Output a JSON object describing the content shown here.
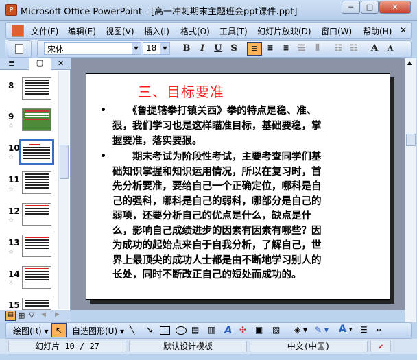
{
  "window": {
    "title": "Microsoft Office PowerPoint - [高一冲刺期末主题班会ppt课件.ppt]",
    "min": "─",
    "max": "□",
    "close": "✕"
  },
  "menu": {
    "items": [
      "文件(F)",
      "编辑(E)",
      "视图(V)",
      "插入(I)",
      "格式(O)",
      "工具(T)",
      "幻灯片放映(D)",
      "窗口(W)",
      "帮助(H)"
    ],
    "close": "✕"
  },
  "toolbar": {
    "font": "宋体",
    "size": "18",
    "bold": "B",
    "italic": "I",
    "underline": "U",
    "shadow": "S",
    "grow": "A",
    "shrink": "A"
  },
  "panel": {
    "tab_outline": "≣",
    "tab_slides": "▢",
    "close": "✕"
  },
  "thumbnails": [
    {
      "num": "8"
    },
    {
      "num": "9"
    },
    {
      "num": "10",
      "selected": true
    },
    {
      "num": "11"
    },
    {
      "num": "12"
    },
    {
      "num": "13"
    },
    {
      "num": "14"
    },
    {
      "num": "15"
    }
  ],
  "slide": {
    "title": "三、目标要准",
    "bullet": "•",
    "p1": [
      "　　《鲁提辖拳打镇关西》拳的特点是稳、准、",
      "狠，我们学习也是这样瞄准目标，基础要稳，掌",
      "握要准，落实要狠。"
    ],
    "p2": [
      "　　期末考试为阶段性考试，主要考查同学们基",
      "础知识掌握和知识运用情况，所以在复习时，首",
      "先分析要准，要给自己一个正确定位，哪科是自",
      "己的强科，哪科是自己的弱科，哪部分是自己的",
      "弱项，还要分析自己的优点是什么，缺点是什",
      "么，影响自己成绩进步的因素有因素有哪些？因",
      "为成功的起始点来自于自我分析，了解自己，世",
      "界上最顶尖的成功人士都是由不断地学习别人的",
      "长处，同时不断改正自己的短处而成功的。"
    ]
  },
  "drawing": {
    "draw": "绘图(R)",
    "autoshapes": "自选图形(U)"
  },
  "status": {
    "slide": "幻灯片 10 / 27",
    "template": "默认设计模板",
    "language": "中文(中国)"
  }
}
